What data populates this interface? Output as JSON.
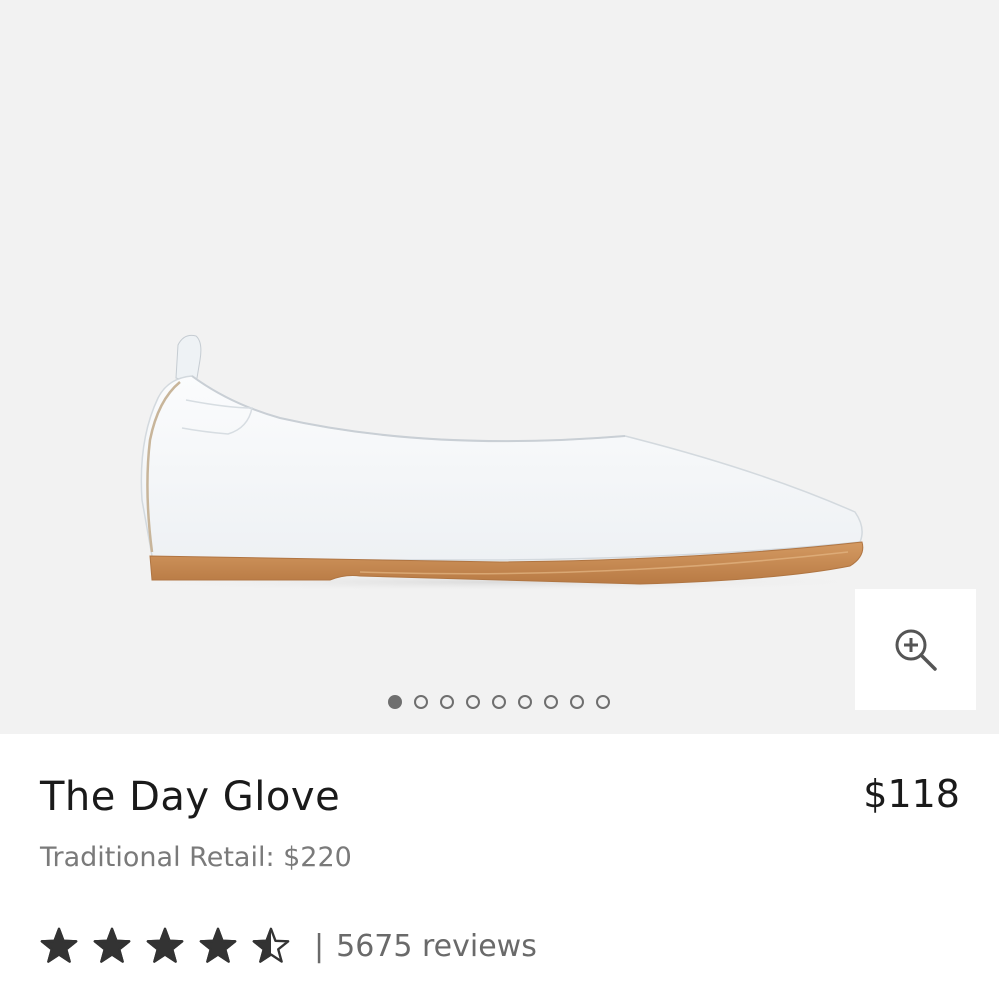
{
  "gallery": {
    "image_subject": "white leather flat shoe with tan sole",
    "image_count": 9,
    "active_index": 0,
    "zoom_icon": "zoom-in-icon"
  },
  "product": {
    "title": "The Day Glove",
    "price": "$118",
    "traditional_retail": "Traditional Retail: $220"
  },
  "rating": {
    "value": 4.5,
    "max": 5,
    "star_icon": "star-icon",
    "separator": "|",
    "reviews_label": "5675 reviews"
  },
  "colors": {
    "gallery_background": "#f2f2f2",
    "star": "#333333",
    "muted_text": "#7a7a7a",
    "dot": "#6f6f6f"
  }
}
